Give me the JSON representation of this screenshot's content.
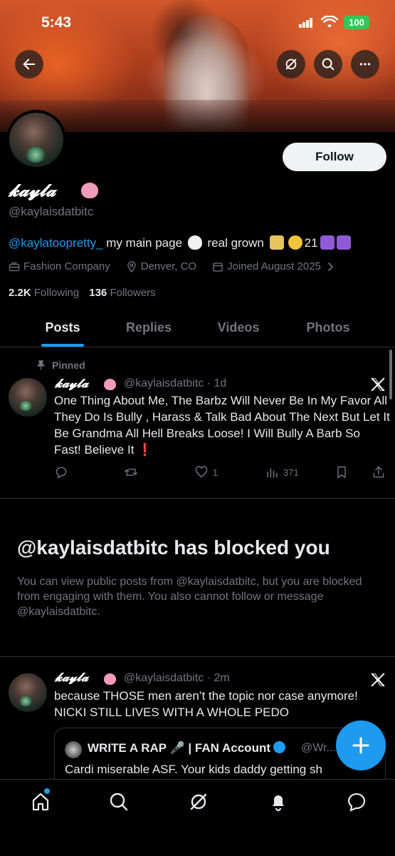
{
  "status_bar": {
    "time": "5:43",
    "battery": "100"
  },
  "header_buttons": {
    "back": "back-arrow-icon",
    "grok": "grok-icon",
    "search": "search-icon",
    "more": "more-icon"
  },
  "profile": {
    "display_name": "𝓴𝓪𝔂𝓵𝓪",
    "handle": "@kaylaisdatbitc",
    "follow_label": "Follow",
    "bio": {
      "mention": "@kaylatoopretty_",
      "text1": " my main page ",
      "text2": " real grown ",
      "text3": "21"
    },
    "category": "Fashion Company",
    "location": "Denver, CO",
    "joined": "Joined August 2025",
    "following_count": "2.2K",
    "following_label": "Following",
    "followers_count": "136",
    "followers_label": "Followers"
  },
  "tabs": [
    "Posts",
    "Replies",
    "Videos",
    "Photos"
  ],
  "pinned_tweet": {
    "pinned_label": "Pinned",
    "name": "𝓴𝓪𝔂𝓵𝓪",
    "handle_time": "@kaylaisdatbitc · 1d",
    "text": "One Thing About Me, The Barbz Will Never Be In My Favor All They Do Is Bully , Harass & Talk Bad About The Next But Let It Be Grandma All Hell Breaks Loose! I Will Bully A Barb So Fast! Believe It ❗",
    "likes": "1",
    "views": "371"
  },
  "blocked": {
    "title": "@kaylaisdatbitc has blocked you",
    "text": "You can view public posts from @kaylaisdatbitc, but you are blocked from engaging with them. You also cannot follow or message @kaylaisdatbitc."
  },
  "second_tweet": {
    "name": "𝓴𝓪𝔂𝓵𝓪",
    "handle_time": "@kaylaisdatbitc · 2m",
    "text": "because THOSE men aren’t the topic nor case anymore! NICKI STILL LIVES WITH A WHOLE PEDO",
    "quote": {
      "name": "WRITE A RAP 🎤 | FAN Account",
      "handle": "@Wr...",
      "text": "Cardi miserable ASF. Your kids daddy getting sh"
    }
  },
  "nav": [
    "home-icon",
    "search-icon",
    "grok-icon",
    "notifications-icon",
    "messages-icon"
  ],
  "colors": {
    "accent": "#1d9bf0",
    "background": "#000000",
    "muted": "#71767b",
    "text": "#e7e9ea"
  }
}
